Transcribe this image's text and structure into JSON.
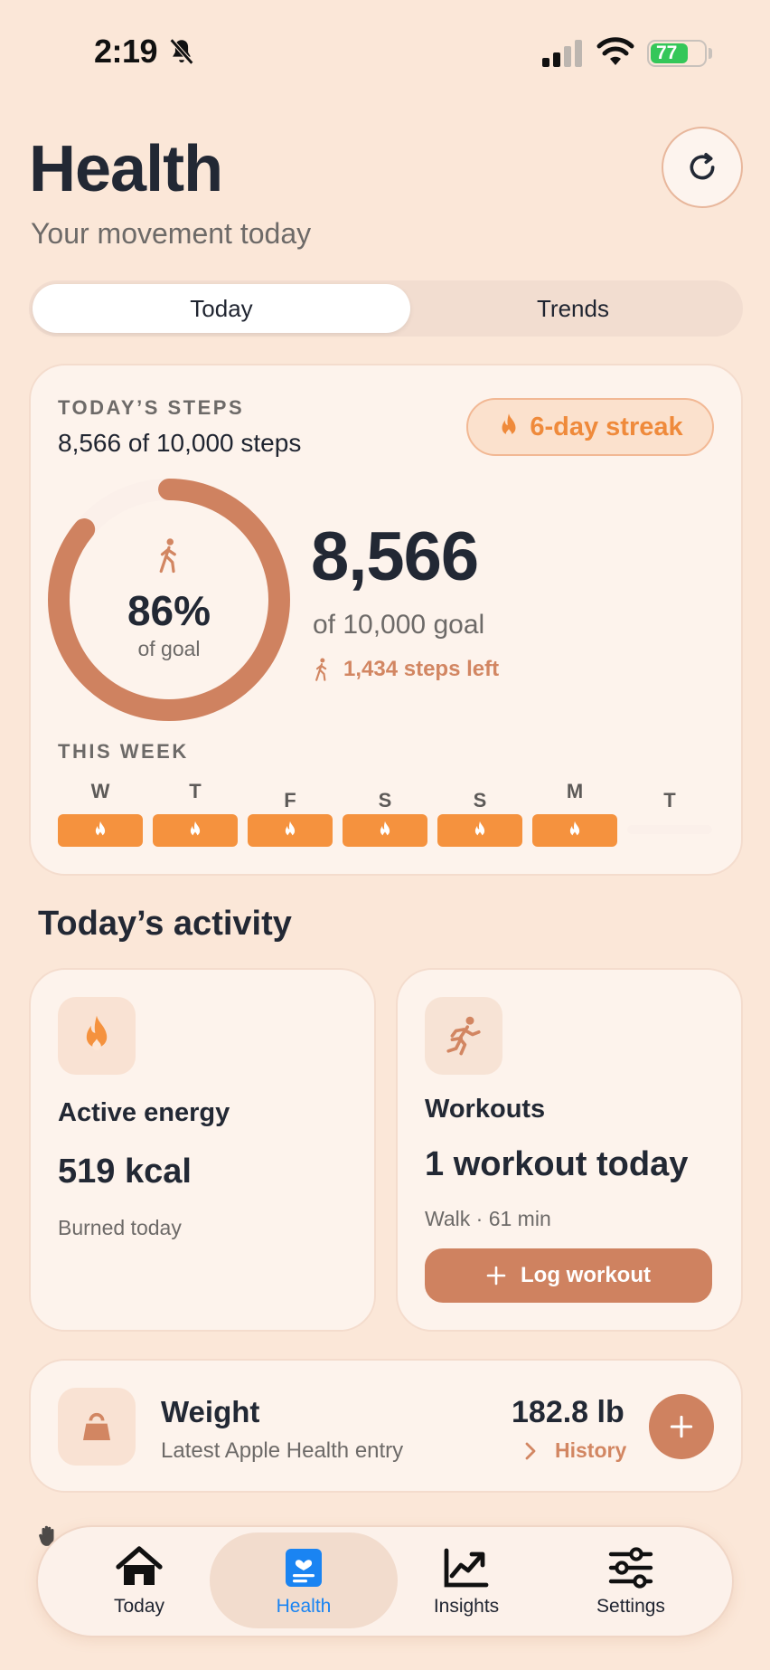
{
  "status_bar": {
    "time": "2:19",
    "battery": "77"
  },
  "header": {
    "title": "Health",
    "subtitle": "Your movement today"
  },
  "segmented": {
    "today": "Today",
    "trends": "Trends"
  },
  "steps": {
    "eyebrow": "TODAY’S STEPS",
    "summary": "8,566 of 10,000 steps",
    "streak": "6-day streak",
    "percent_label": "86%",
    "percent_value": 0.86,
    "of_goal": "of goal",
    "count": "8,566",
    "goal_text": "of 10,000 goal",
    "left_text": "1,434 steps left"
  },
  "week": {
    "label": "THIS WEEK",
    "days": [
      {
        "letter": "W",
        "done": true
      },
      {
        "letter": "T",
        "done": true
      },
      {
        "letter": "F",
        "done": true
      },
      {
        "letter": "S",
        "done": true
      },
      {
        "letter": "S",
        "done": true
      },
      {
        "letter": "M",
        "done": true
      },
      {
        "letter": "T",
        "done": false
      }
    ]
  },
  "activity": {
    "section_title": "Today’s activity",
    "energy": {
      "title": "Active energy",
      "value": "519 kcal",
      "sub": "Burned today"
    },
    "workouts": {
      "title": "Workouts",
      "value": "1 workout today",
      "sub": "Walk · 61 min",
      "button": "Log workout"
    }
  },
  "weight": {
    "title": "Weight",
    "sub": "Latest Apple Health entry",
    "value": "182.8 lb",
    "history": "History"
  },
  "tabs": [
    {
      "label": "Today"
    },
    {
      "label": "Health"
    },
    {
      "label": "Insights"
    },
    {
      "label": "Settings"
    }
  ],
  "colors": {
    "accent": "#cf8260",
    "streak": "#f5923e",
    "active_tab": "#1a84f2",
    "background": "#fbe7d8"
  }
}
